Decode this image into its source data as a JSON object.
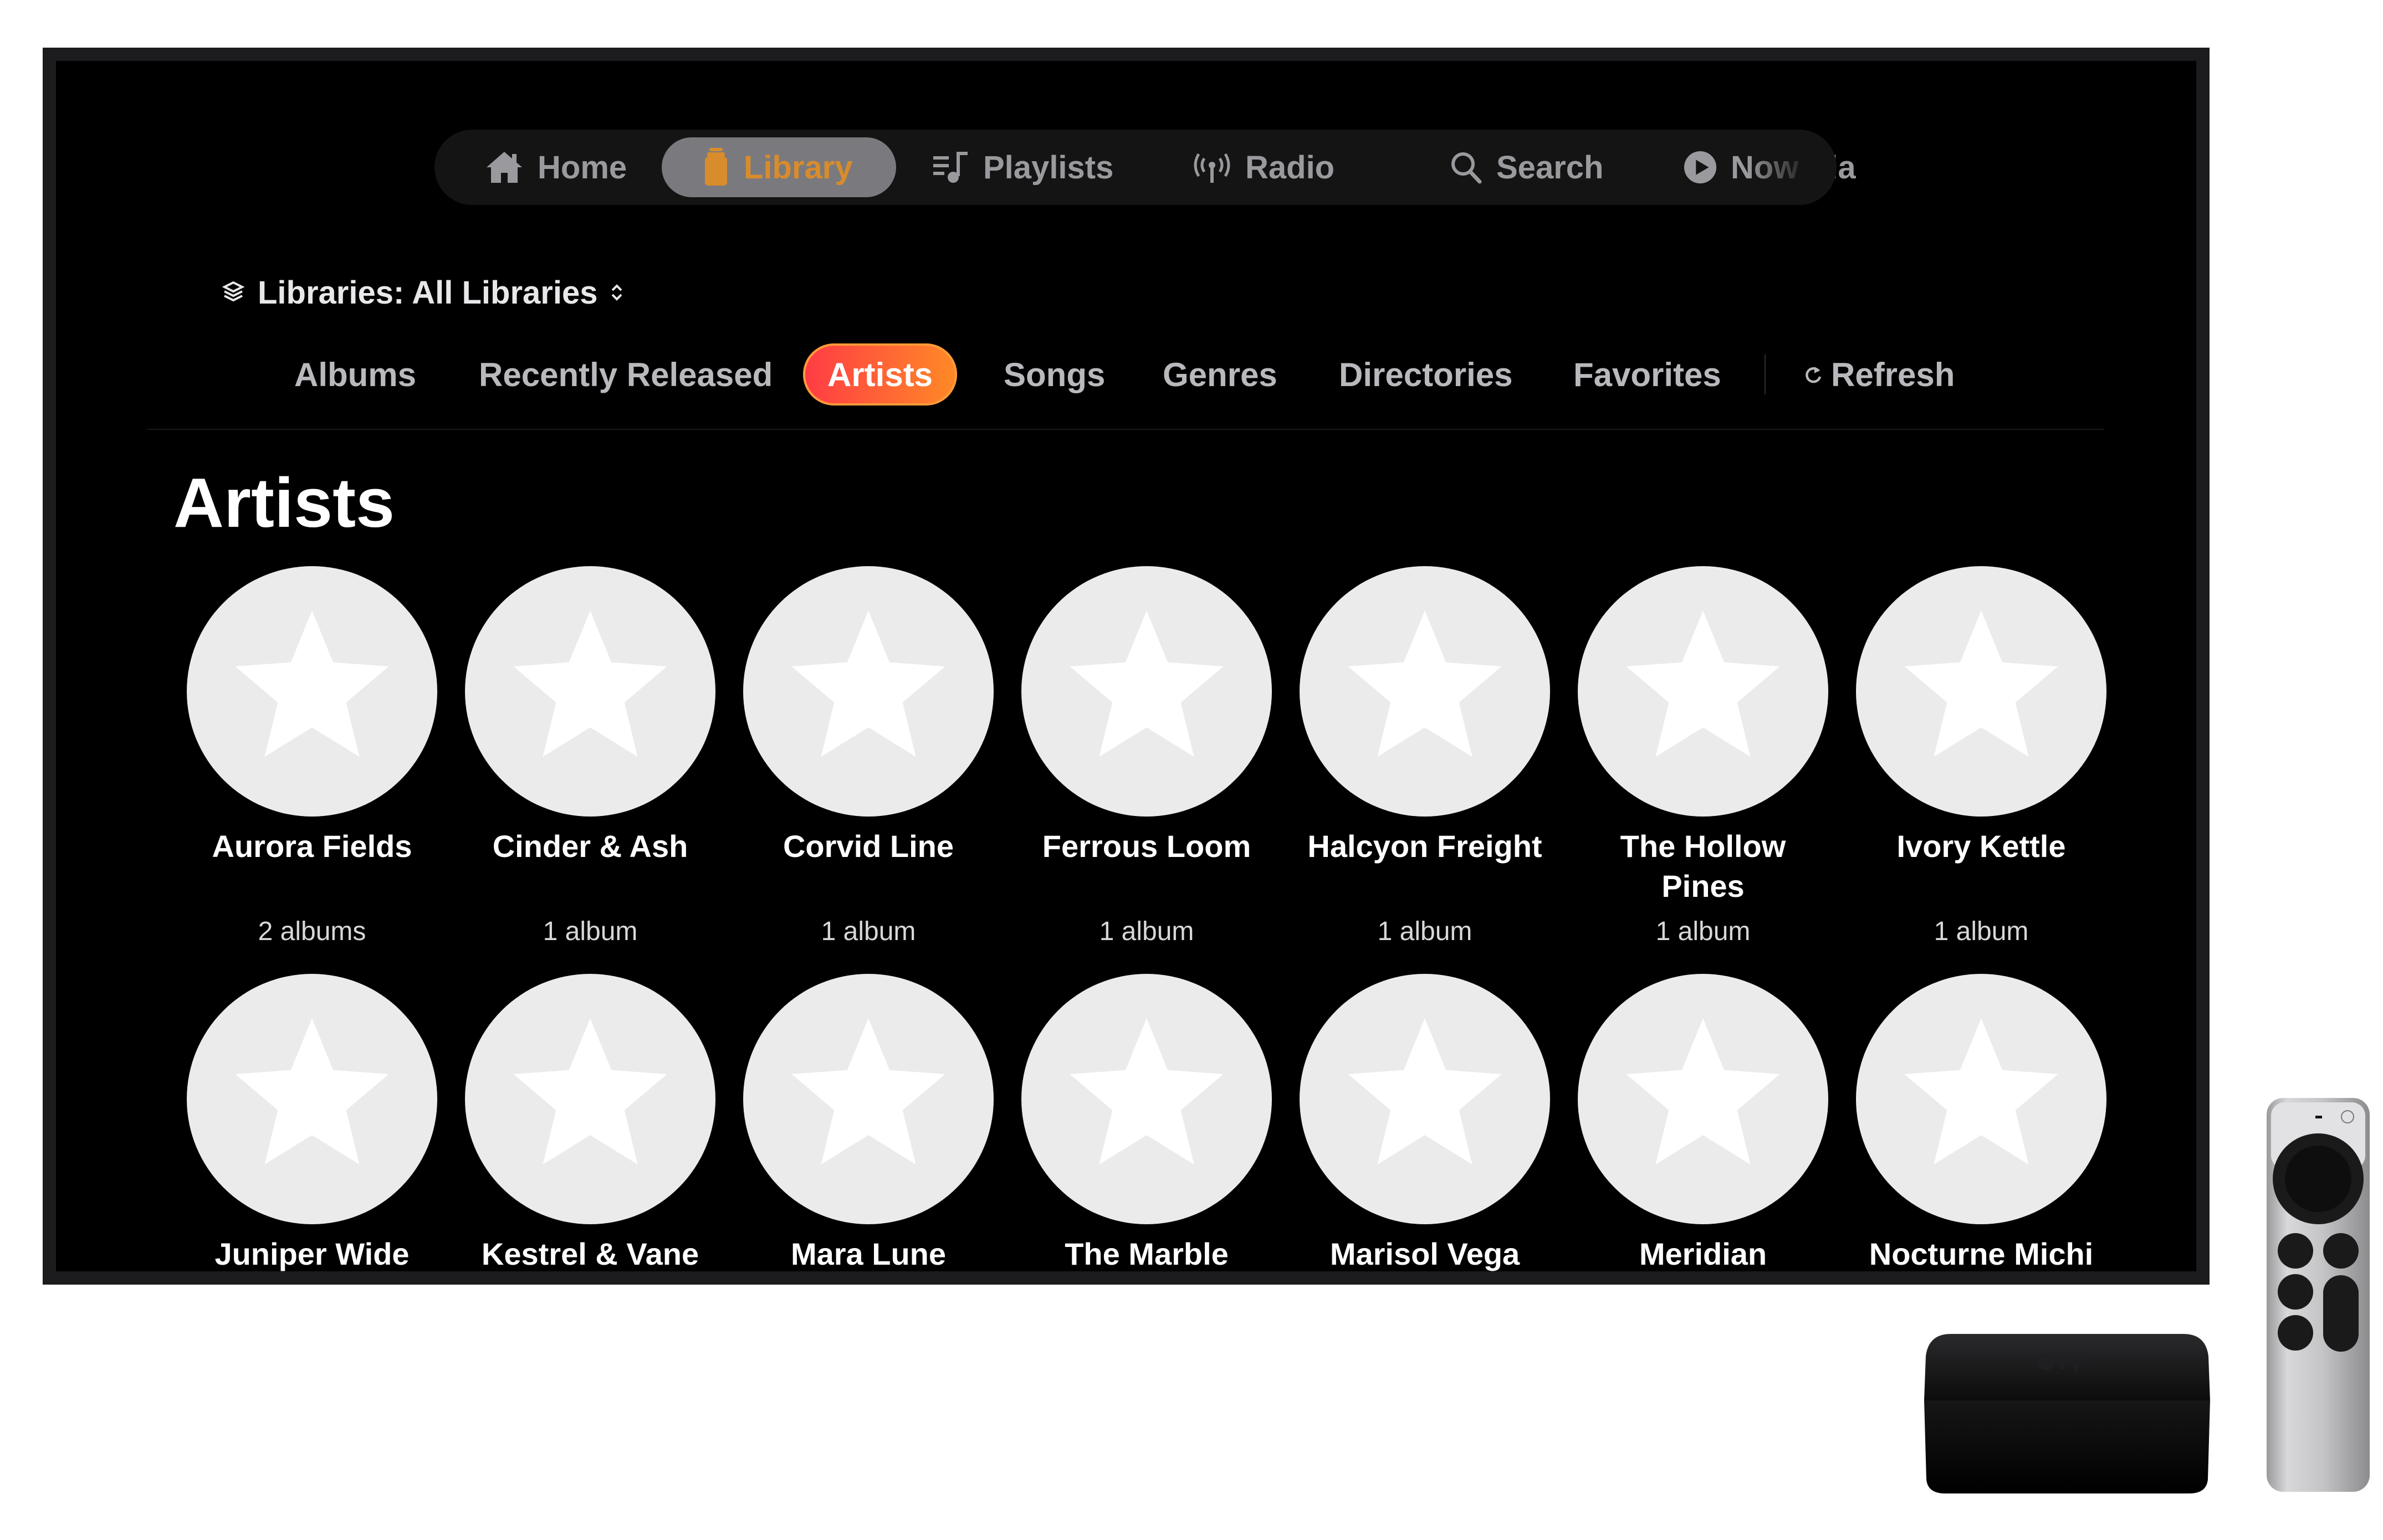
{
  "nav": {
    "items": [
      {
        "label": "Home",
        "icon": "house-icon"
      },
      {
        "label": "Library",
        "icon": "library-icon",
        "selected": true
      },
      {
        "label": "Playlists",
        "icon": "playlist-icon"
      },
      {
        "label": "Radio",
        "icon": "radio-icon"
      },
      {
        "label": "Search",
        "icon": "magnifier-icon"
      },
      {
        "label": "Now Pla",
        "icon": "play-circle-icon"
      }
    ]
  },
  "library_selector": {
    "label": "Libraries: All Libraries"
  },
  "categories": [
    {
      "label": "Albums"
    },
    {
      "label": "Recently Released"
    },
    {
      "label": "Artists",
      "active": true
    },
    {
      "label": "Songs"
    },
    {
      "label": "Genres"
    },
    {
      "label": "Directories"
    },
    {
      "label": "Favorites"
    }
  ],
  "refresh_label": "Refresh",
  "section_title": "Artists",
  "artists": [
    {
      "name": "Aurora Fields",
      "count": "2 albums"
    },
    {
      "name": "Cinder & Ash",
      "count": "1 album"
    },
    {
      "name": "Corvid Line",
      "count": "1 album"
    },
    {
      "name": "Ferrous Loom",
      "count": "1 album"
    },
    {
      "name": "Halcyon Freight",
      "count": "1 album"
    },
    {
      "name": "The Hollow Pines",
      "count": "1 album"
    },
    {
      "name": "Ivory Kettle",
      "count": "1 album"
    },
    {
      "name": "Juniper Wide"
    },
    {
      "name": "Kestrel & Vane"
    },
    {
      "name": "Mara Lune"
    },
    {
      "name": "The Marble"
    },
    {
      "name": "Marisol Vega"
    },
    {
      "name": "Meridian"
    },
    {
      "name": "Nocturne Michi"
    }
  ],
  "colors": {
    "accent_gradient_start": "#ff3b45",
    "accent_gradient_end": "#ff8a26",
    "library_icon": "#d98c2b",
    "avatar_bg": "#ebebeb"
  }
}
